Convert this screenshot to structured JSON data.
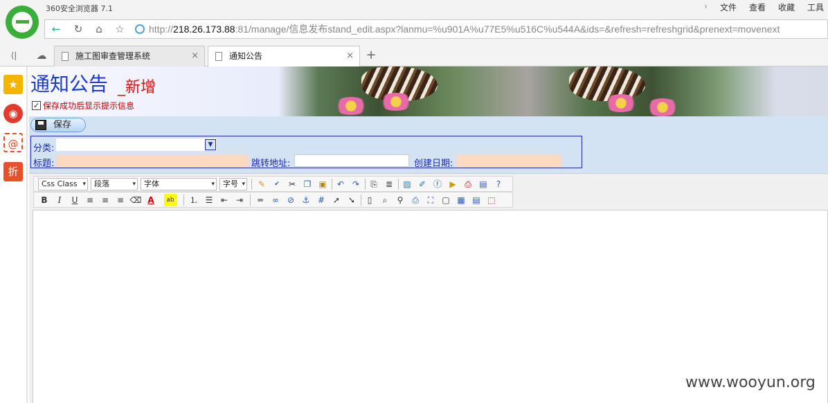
{
  "browser": {
    "name": "360安全浏览器 7.1",
    "menu": [
      "文件",
      "查看",
      "收藏",
      "工具"
    ],
    "url_prefix": "http://",
    "url_host": "218.26.173.88",
    "url_rest": ":81/manage/信息发布stand_edit.aspx?lanmu=%u901A%u77E5%u516C%u544A&ids=&refresh=refreshgrid&prenext=movenext",
    "tabs": [
      {
        "label": "施工图审查管理系统",
        "active": false
      },
      {
        "label": "通知公告",
        "active": true
      }
    ],
    "new_tab": "+"
  },
  "page": {
    "title": "通知公告",
    "subtitle": "_新增",
    "checkbox_label": "保存成功后显示提示信息",
    "checkbox_checked": "✓",
    "save_label": "保存"
  },
  "form": {
    "category_label": "分类:",
    "title_label": "标题:",
    "jump_label": "跳转地址:",
    "date_label": "创建日期:"
  },
  "editor": {
    "css_class": "Css Class",
    "paragraph": "段落",
    "font": "字体",
    "size": "字号"
  },
  "watermark": "www.wooyun.org"
}
